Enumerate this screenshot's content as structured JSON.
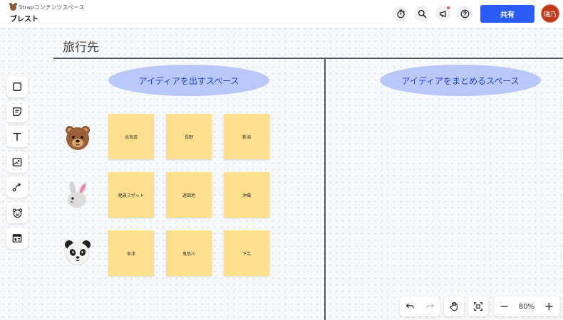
{
  "header": {
    "workspace_name": "Strapコンテンツスペース",
    "board_name": "ブレスト",
    "buttons": [
      "timer-icon",
      "search-icon",
      "announcement-icon",
      "help-icon"
    ],
    "share_label": "共有",
    "avatar_initials": "瑞乃"
  },
  "frame": {
    "title": "旅行先",
    "left_section_label": "アイディアを出すスペース",
    "right_section_label": "アイディアをまとめるスペース"
  },
  "toolbar": {
    "tools": [
      "square-icon",
      "sticky-note-icon",
      "text-icon",
      "image-icon",
      "connector-icon",
      "stamp-icon",
      "template-icon"
    ]
  },
  "rows": [
    {
      "animal": "bear-icon",
      "notes": [
        "北海道",
        "長野",
        "新潟"
      ]
    },
    {
      "animal": "rabbit-icon",
      "notes": [
        "絶景スポット",
        "遊園地",
        "沖縄"
      ]
    },
    {
      "animal": "panda-icon",
      "notes": [
        "草津",
        "鬼怒川",
        "下呂"
      ]
    }
  ],
  "bottom_controls": {
    "zoom_level": "80%",
    "zoom_out_label": "−",
    "zoom_in_label": "+"
  },
  "colors": {
    "accent": "#2a5cf6",
    "sticky": "#ffe08f",
    "section_label_bg": "#bac7f9",
    "avatar": "#c0391b"
  }
}
